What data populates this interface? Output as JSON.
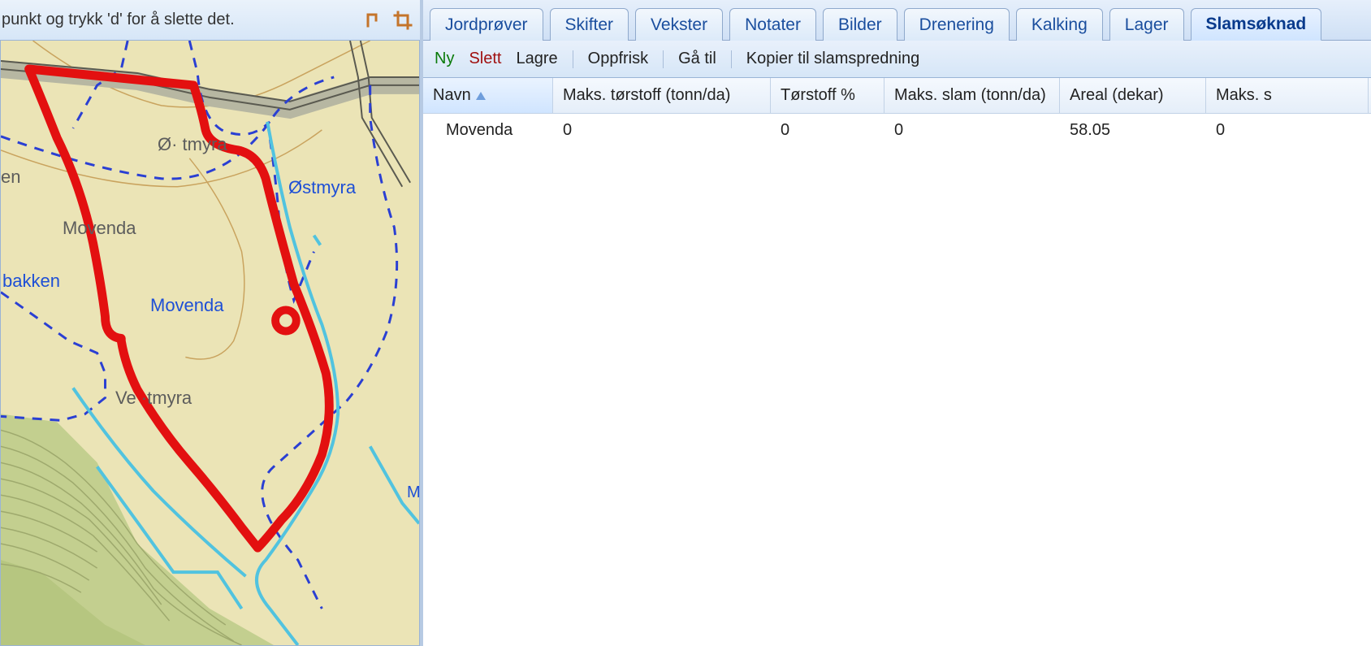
{
  "left": {
    "hint": " punkt og trykk 'd' for å slette det.",
    "labels": {
      "ostmyra_grey": "Ø· tmyra",
      "ostmyra_blue": "Østmyra",
      "en": "en",
      "movenda_grey": "Movenda",
      "bakken": "bakken",
      "movenda_blue": "Movenda",
      "vestmyra": "Ve ·tmyra",
      "m_cut": "M"
    }
  },
  "tabs": [
    {
      "label": "Jordprøver",
      "active": false
    },
    {
      "label": "Skifter",
      "active": false
    },
    {
      "label": "Vekster",
      "active": false
    },
    {
      "label": "Notater",
      "active": false
    },
    {
      "label": "Bilder",
      "active": false
    },
    {
      "label": "Drenering",
      "active": false
    },
    {
      "label": "Kalking",
      "active": false
    },
    {
      "label": "Lager",
      "active": false
    },
    {
      "label": "Slamsøknad",
      "active": true
    }
  ],
  "toolbar2": {
    "ny": "Ny",
    "slett": "Slett",
    "lagre": "Lagre",
    "oppfrisk": "Oppfrisk",
    "ga_til": "Gå til",
    "kopier": "Kopier til slamspredning"
  },
  "grid": {
    "columns": [
      {
        "label": "Navn",
        "sorted": "asc"
      },
      {
        "label": "Maks. tørstoff (tonn/da)"
      },
      {
        "label": "Tørstoff %"
      },
      {
        "label": "Maks. slam (tonn/da)"
      },
      {
        "label": "Areal (dekar)"
      },
      {
        "label": "Maks. s"
      }
    ],
    "rows": [
      {
        "cells": [
          "Movenda",
          "0",
          "0",
          "0",
          "58.05",
          "0"
        ]
      }
    ]
  }
}
